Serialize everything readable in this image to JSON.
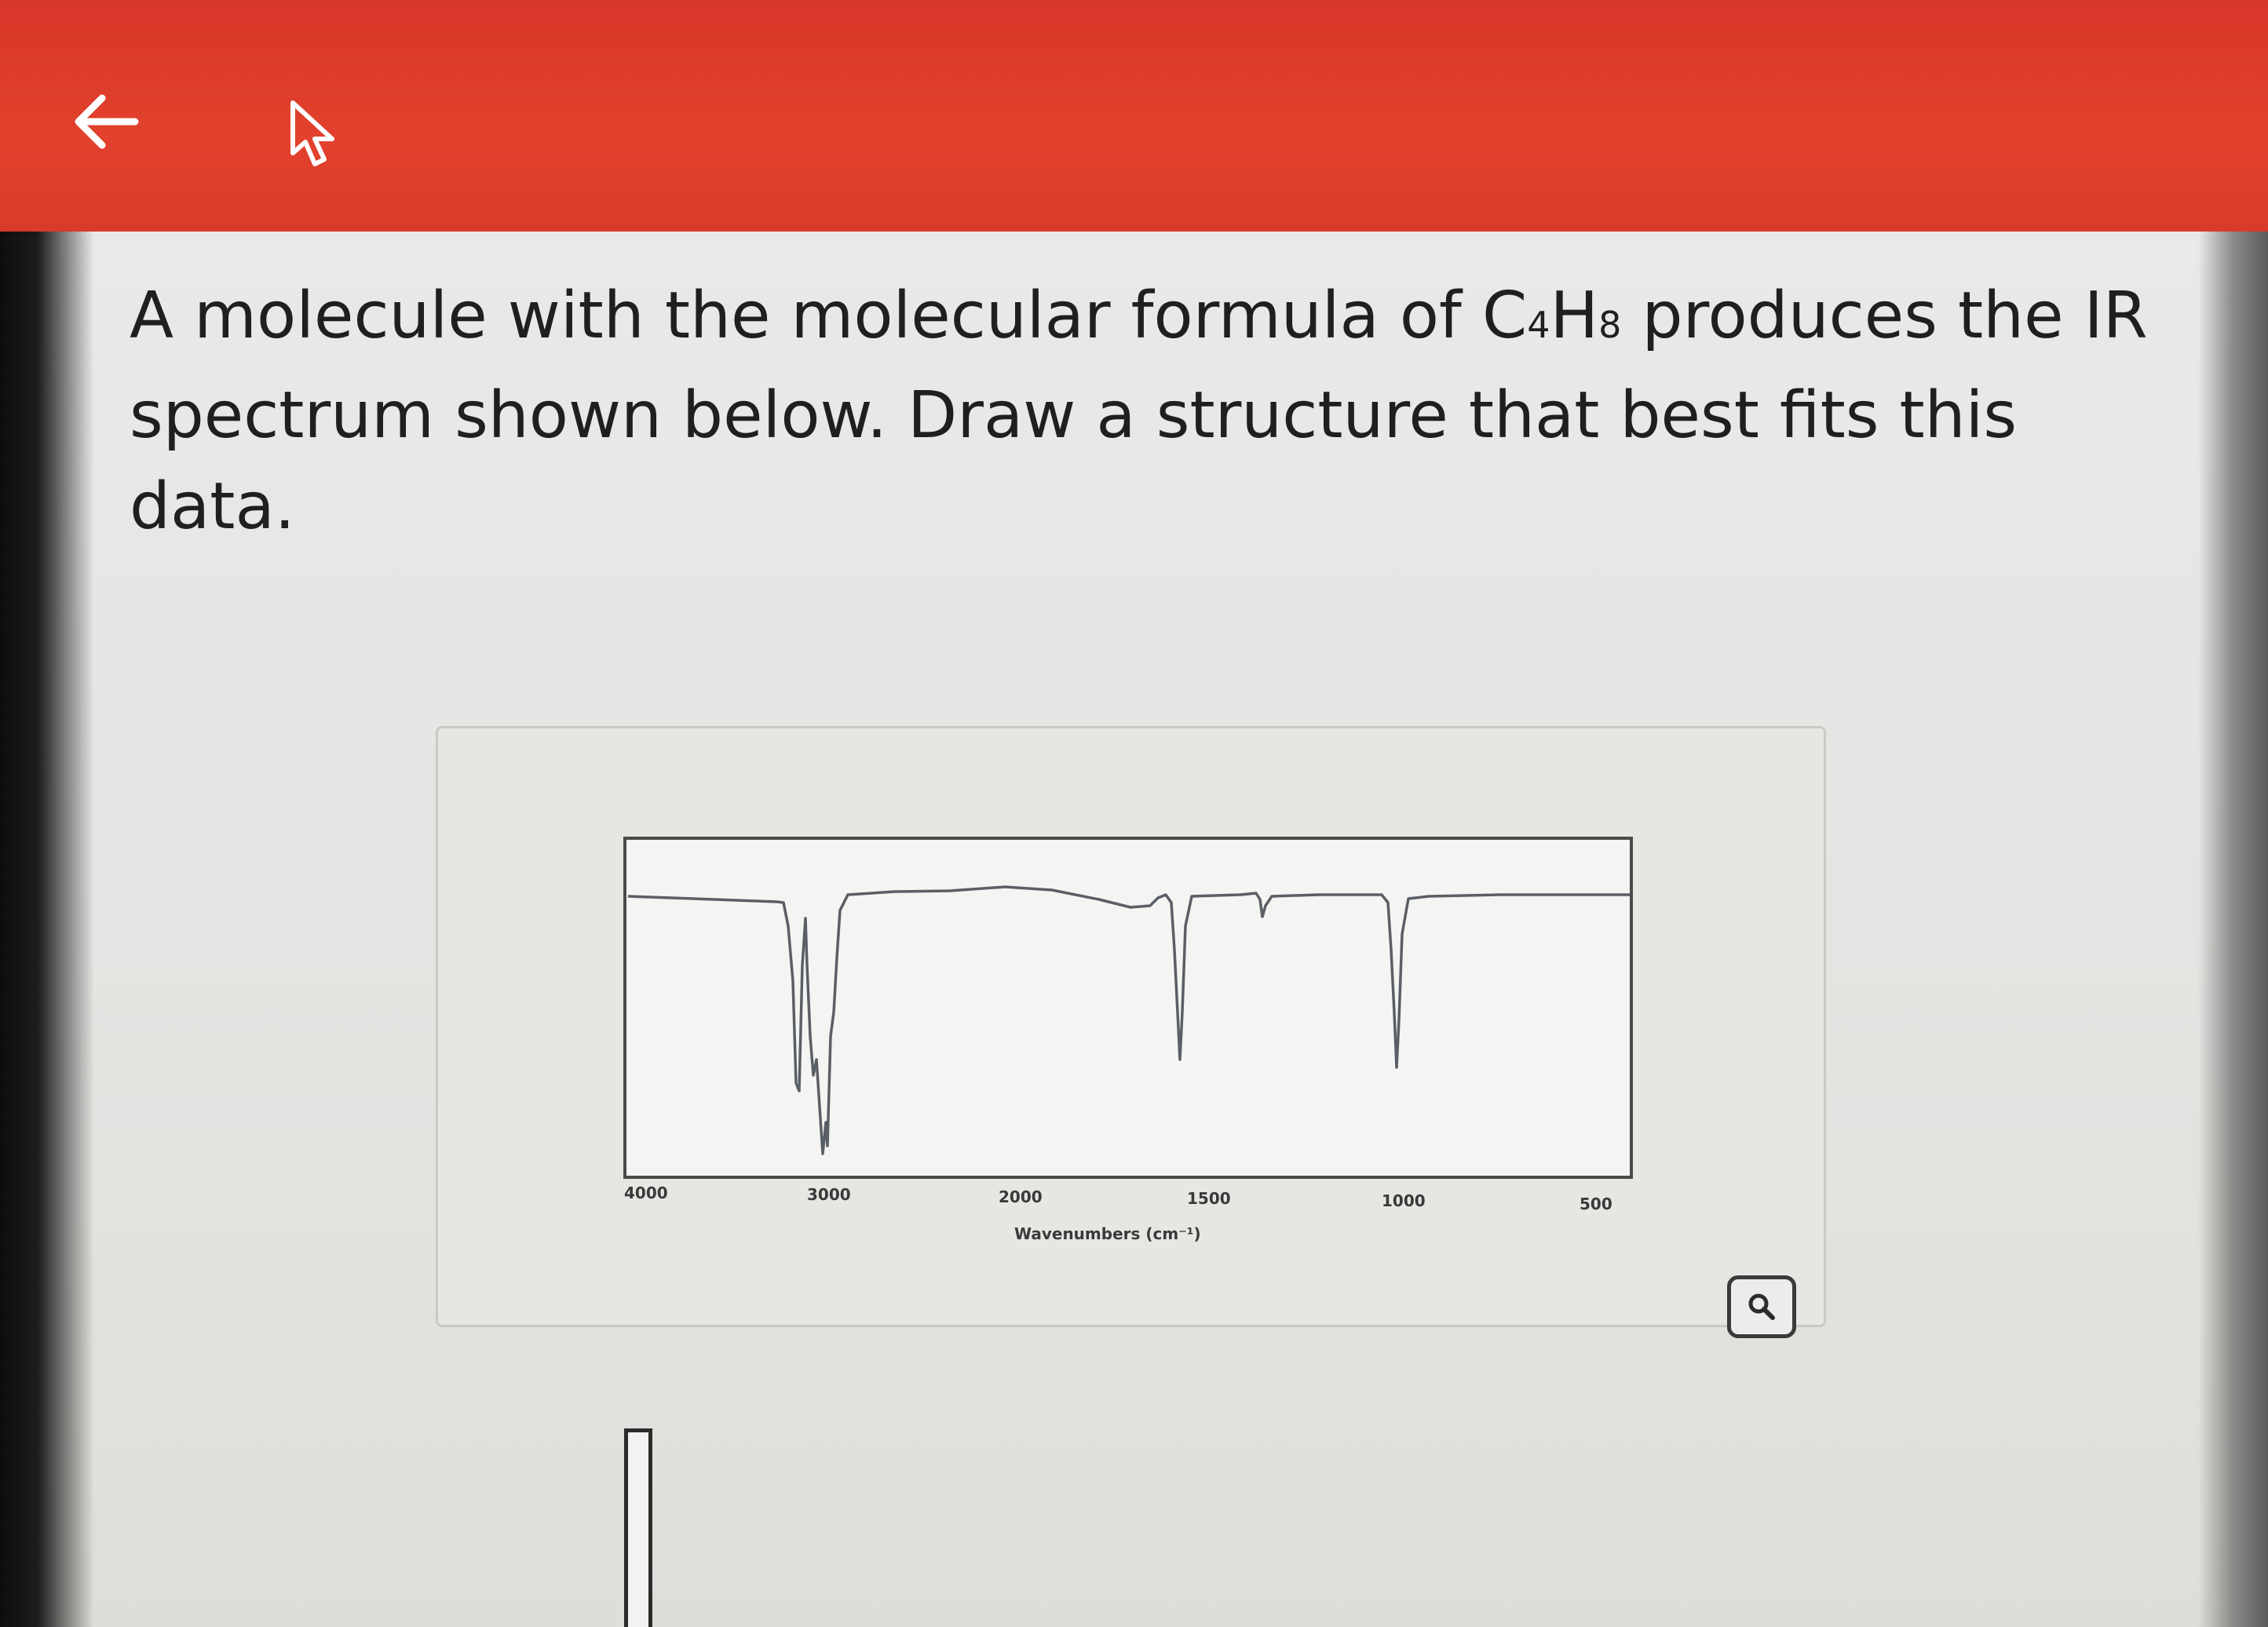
{
  "header": {
    "back_icon": "arrow-left-icon",
    "cursor_icon": "mouse-pointer-icon",
    "accent_color": "#e0402d"
  },
  "question": {
    "before_formula": "A molecule with the molecular formula of C",
    "sub1": "4",
    "mid_formula": "H",
    "sub2": "8",
    "after_formula": " produces the IR spectrum shown below. Draw a structure that best fits this data."
  },
  "spectrum": {
    "xlabel": "Wavenumbers (cm⁻¹)",
    "ticks": [
      "4000",
      "3000",
      "2000",
      "1500",
      "1000",
      "500"
    ]
  },
  "zoom": {
    "icon": "magnifier-icon"
  }
}
